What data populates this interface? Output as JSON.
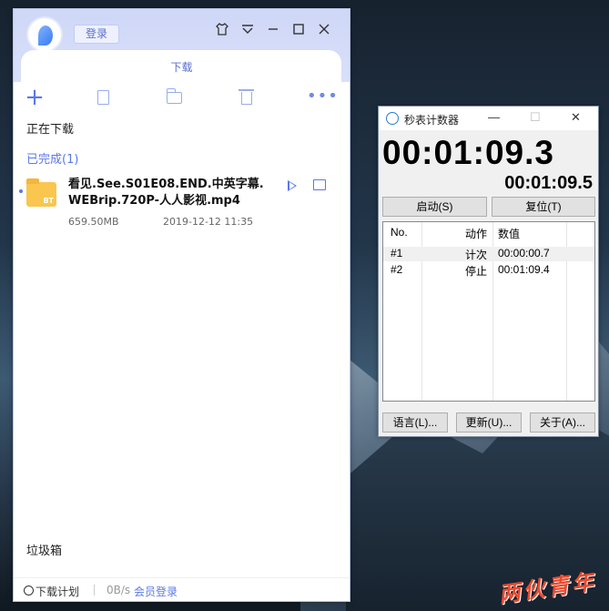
{
  "xunlei": {
    "login_label": "登录",
    "title_icons": [
      "skin-icon",
      "menu-icon",
      "minimize-icon",
      "maximize-icon",
      "close-icon"
    ],
    "tab_label": "下载",
    "toolbar_icons": [
      "add-icon",
      "file-icon",
      "folder-icon",
      "trash-icon",
      "more-icon"
    ],
    "section_downloading": "正在下载",
    "section_completed": "已完成(1)",
    "task": {
      "badge": "BT",
      "name": "看见.See.S01E08.END.中英字幕.WEBrip.720P-人人影视.mp4",
      "size": "659.50MB",
      "time": "2019-12-12 11:35"
    },
    "trash_label": "垃圾箱",
    "status": {
      "plan_label": "下载计划",
      "speed": "0B/s",
      "vip_login": "会员登录"
    },
    "accent": "#5a78e6"
  },
  "stopwatch": {
    "title": "秒表计数器",
    "main_time": "00:01:09.3",
    "sub_time": "00:01:09.5",
    "start_button": "启动(S)",
    "reset_button": "复位(T)",
    "columns": [
      "No.",
      "动作",
      "数值"
    ],
    "rows": [
      {
        "no": "#1",
        "action": "计次",
        "value": "00:00:00.7"
      },
      {
        "no": "#2",
        "action": "停止",
        "value": "00:01:09.4"
      }
    ],
    "language_button": "语言(L)...",
    "update_button": "更新(U)...",
    "about_button": "关于(A)..."
  },
  "watermark": "两伙青年"
}
